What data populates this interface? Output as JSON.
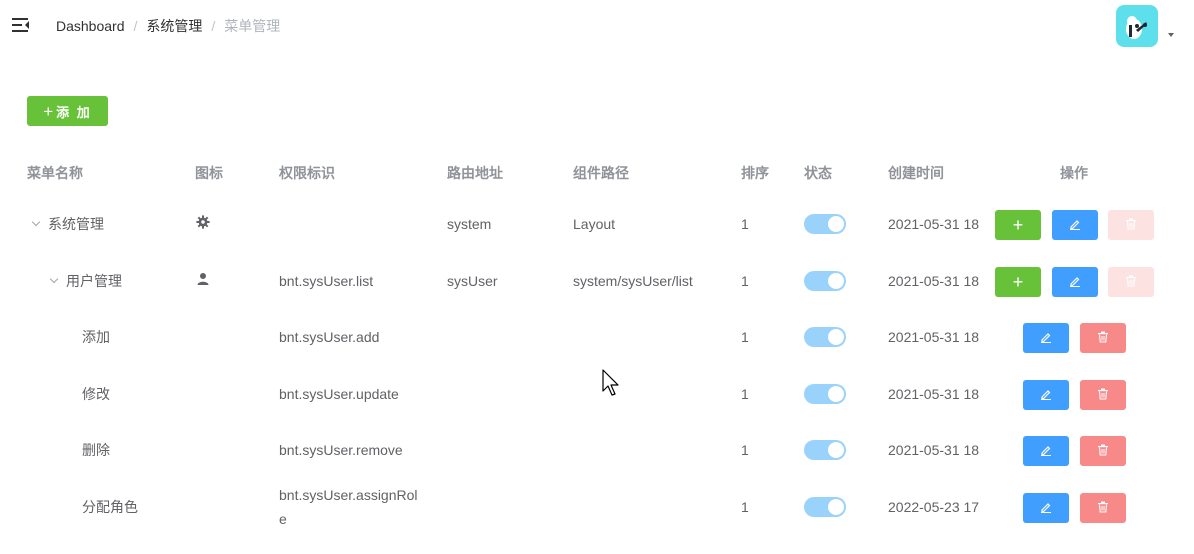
{
  "navbar": {
    "hamburger_icon": "hamburger-menu-icon",
    "breadcrumb": [
      "Dashboard",
      "系统管理",
      "菜单管理"
    ],
    "breadcrumb_separator": "/",
    "avatar_icon": "user-avatar-image"
  },
  "toolbar": {
    "add_icon": "plus-icon",
    "add_label": "添 加"
  },
  "table": {
    "columns": [
      "菜单名称",
      "图标",
      "权限标识",
      "路由地址",
      "组件路径",
      "排序",
      "状态",
      "创建时间",
      "操作"
    ],
    "rows": [
      {
        "name": "系统管理",
        "level": 0,
        "expand": true,
        "icon": "gear-icon",
        "perms": "",
        "path": "system",
        "component": "Layout",
        "sort": "1",
        "status": true,
        "created": "2021-05-31 18",
        "actions": [
          "add",
          "edit",
          "delete-disabled"
        ]
      },
      {
        "name": "用户管理",
        "level": 1,
        "expand": true,
        "icon": "user-icon",
        "perms": "bnt.sysUser.list",
        "path": "sysUser",
        "component": "system/sysUser/list",
        "sort": "1",
        "status": true,
        "created": "2021-05-31 18",
        "actions": [
          "add",
          "edit",
          "delete-disabled"
        ]
      },
      {
        "name": "添加",
        "level": 2,
        "expand": false,
        "icon": "",
        "perms": "bnt.sysUser.add",
        "path": "",
        "component": "",
        "sort": "1",
        "status": true,
        "created": "2021-05-31 18",
        "actions": [
          "edit",
          "delete"
        ]
      },
      {
        "name": "修改",
        "level": 2,
        "expand": false,
        "icon": "",
        "perms": "bnt.sysUser.update",
        "path": "",
        "component": "",
        "sort": "1",
        "status": true,
        "created": "2021-05-31 18",
        "actions": [
          "edit",
          "delete"
        ]
      },
      {
        "name": "删除",
        "level": 2,
        "expand": false,
        "icon": "",
        "perms": "bnt.sysUser.remove",
        "path": "",
        "component": "",
        "sort": "1",
        "status": true,
        "created": "2021-05-31 18",
        "actions": [
          "edit",
          "delete"
        ]
      },
      {
        "name": "分配角色",
        "level": 2,
        "expand": false,
        "icon": "",
        "perms": "bnt.sysUser.assignRol",
        "perms_wrap": "e",
        "path": "",
        "component": "",
        "sort": "1",
        "status": true,
        "created": "2022-05-23 17",
        "actions": [
          "edit",
          "delete"
        ]
      }
    ]
  },
  "colors": {
    "primary": "#409eff",
    "success": "#67c23a",
    "danger": "#f78989",
    "danger_disabled": "#fde2e2",
    "switch_on": "#99d3fb"
  }
}
